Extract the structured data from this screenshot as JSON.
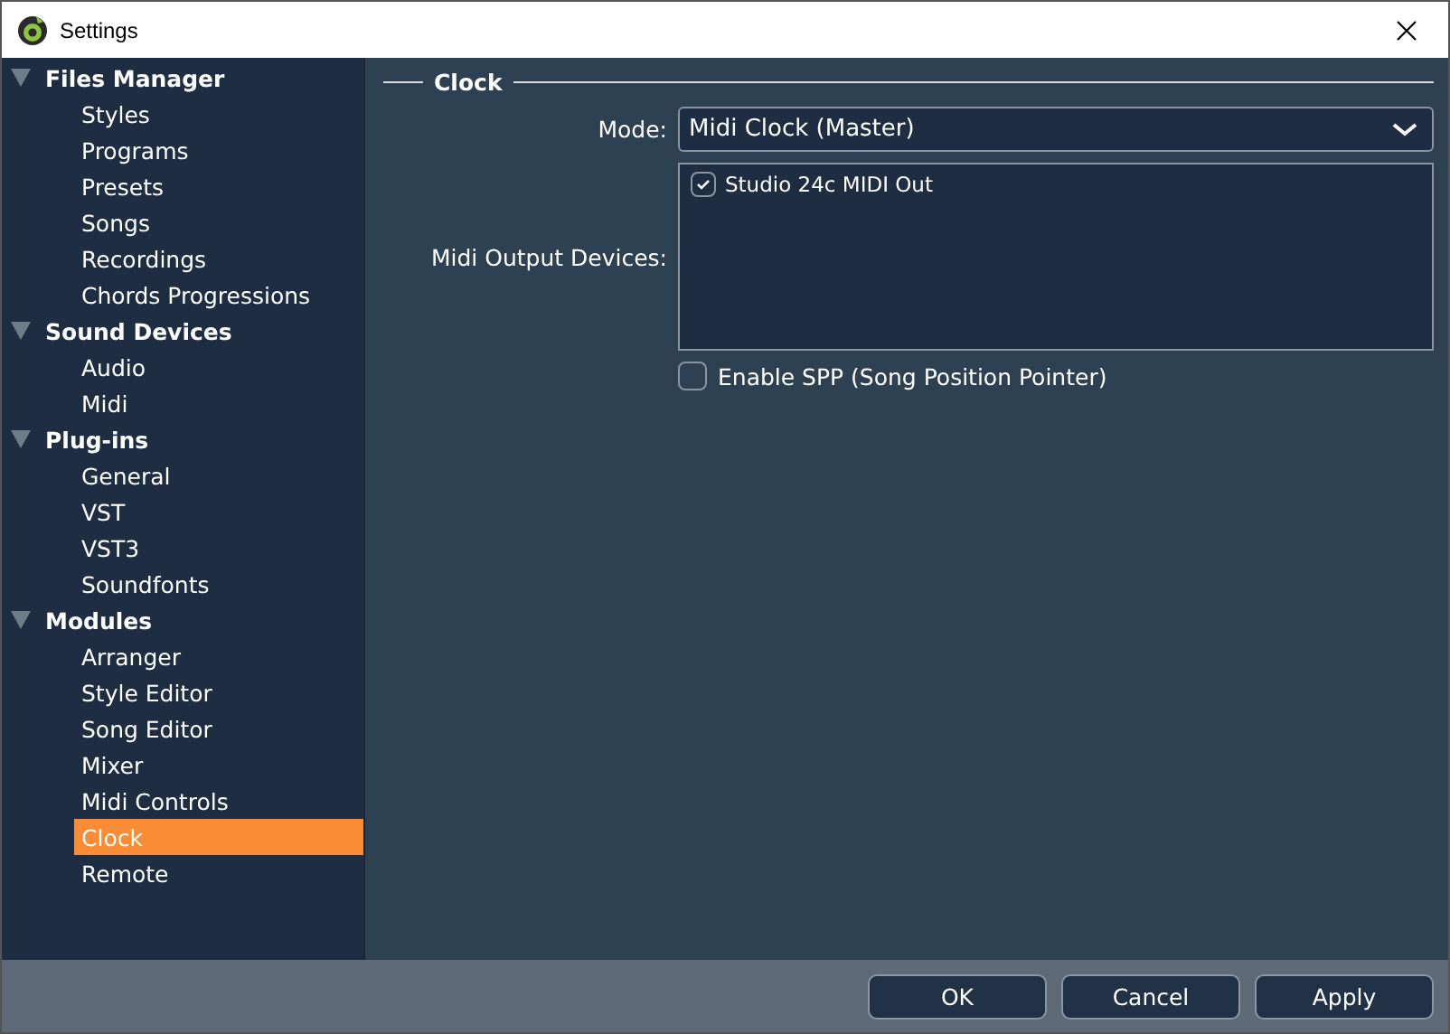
{
  "window": {
    "title": "Settings"
  },
  "sidebar": {
    "groups": [
      {
        "label": "Files Manager",
        "expanded": true,
        "children": [
          {
            "label": "Styles",
            "selected": false
          },
          {
            "label": "Programs",
            "selected": false
          },
          {
            "label": "Presets",
            "selected": false
          },
          {
            "label": "Songs",
            "selected": false
          },
          {
            "label": "Recordings",
            "selected": false
          },
          {
            "label": "Chords Progressions",
            "selected": false
          }
        ]
      },
      {
        "label": "Sound Devices",
        "expanded": true,
        "children": [
          {
            "label": "Audio",
            "selected": false
          },
          {
            "label": "Midi",
            "selected": false
          }
        ]
      },
      {
        "label": "Plug-ins",
        "expanded": true,
        "children": [
          {
            "label": "General",
            "selected": false
          },
          {
            "label": "VST",
            "selected": false
          },
          {
            "label": "VST3",
            "selected": false
          },
          {
            "label": "Soundfonts",
            "selected": false
          }
        ]
      },
      {
        "label": "Modules",
        "expanded": true,
        "children": [
          {
            "label": "Arranger",
            "selected": false
          },
          {
            "label": "Style Editor",
            "selected": false
          },
          {
            "label": "Song Editor",
            "selected": false
          },
          {
            "label": "Mixer",
            "selected": false
          },
          {
            "label": "Midi Controls",
            "selected": false
          },
          {
            "label": "Clock",
            "selected": true
          },
          {
            "label": "Remote",
            "selected": false
          }
        ]
      }
    ]
  },
  "section": {
    "title": "Clock",
    "mode": {
      "label": "Mode:",
      "value": "Midi Clock (Master)"
    },
    "outputs": {
      "label": "Midi Output Devices:",
      "devices": [
        {
          "label": "Studio 24c MIDI Out",
          "checked": true
        }
      ]
    },
    "spp": {
      "label": "Enable SPP (Song Position Pointer)",
      "checked": false
    }
  },
  "buttons": [
    "OK",
    "Cancel",
    "Apply"
  ]
}
